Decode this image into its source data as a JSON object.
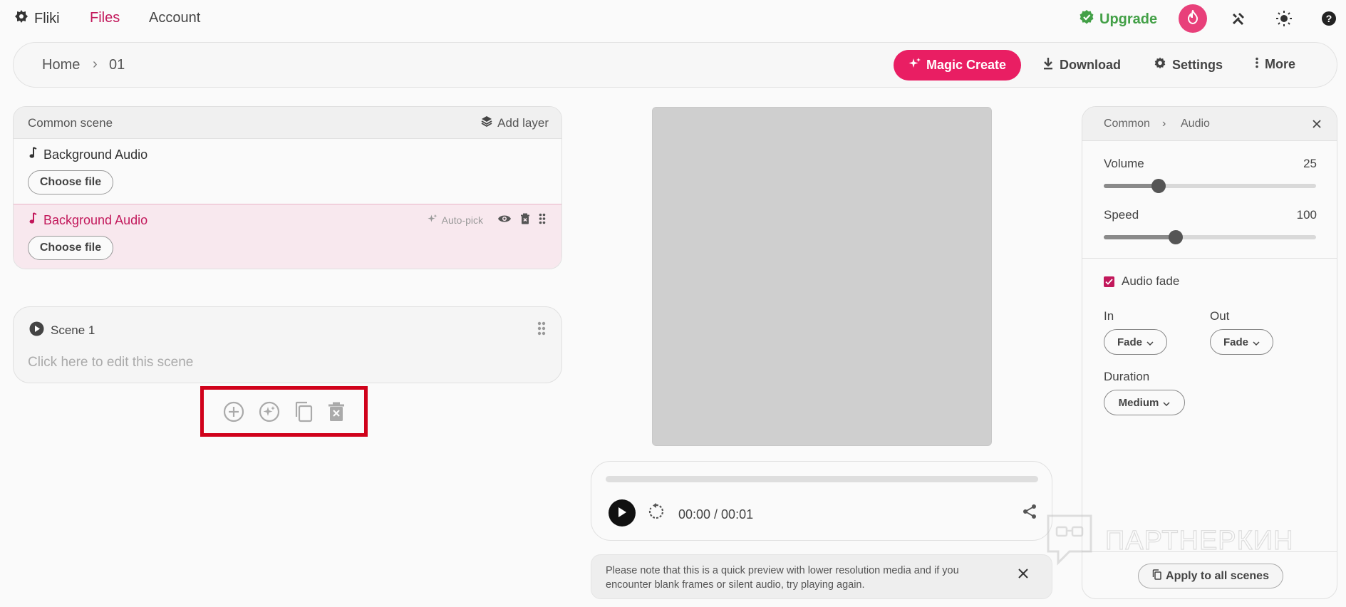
{
  "nav": {
    "brand": "Fliki",
    "files": "Files",
    "account": "Account",
    "upgrade": "Upgrade"
  },
  "toolbar": {
    "crumb_home": "Home",
    "crumb_sep": "›",
    "crumb_file": "01",
    "magic_create": "Magic Create",
    "download": "Download",
    "settings": "Settings",
    "more": "More"
  },
  "layers": {
    "header_title": "Common scene",
    "add_layer": "Add layer",
    "items": [
      {
        "name": "Background Audio",
        "choose": "Choose file"
      },
      {
        "name": "Background Audio",
        "choose": "Choose file",
        "auto_pick": "Auto-pick"
      }
    ]
  },
  "scene": {
    "title": "Scene 1",
    "placeholder": "Click here to edit this scene"
  },
  "player": {
    "time": "00:00 / 00:01",
    "notice": "Please note that this is a quick preview with lower resolution media and if you encounter blank frames or silent audio, try playing again."
  },
  "panel": {
    "crumb_common": "Common",
    "crumb_sep": "›",
    "crumb_audio": "Audio",
    "volume_label": "Volume",
    "volume_value": "25",
    "volume_level": 0.26,
    "speed_label": "Speed",
    "speed_value": "100",
    "speed_level": 0.34,
    "audio_fade": "Audio fade",
    "in_label": "In",
    "in_value": "Fade",
    "out_label": "Out",
    "out_value": "Fade",
    "duration_label": "Duration",
    "duration_value": "Medium",
    "apply": "Apply to all scenes"
  },
  "watermark": "ПАРТНЕРКИН",
  "colors": {
    "accent": "#e91e63",
    "accent_text": "#c2185b",
    "upgrade": "#43a047",
    "highlight_box": "#d0021b"
  }
}
